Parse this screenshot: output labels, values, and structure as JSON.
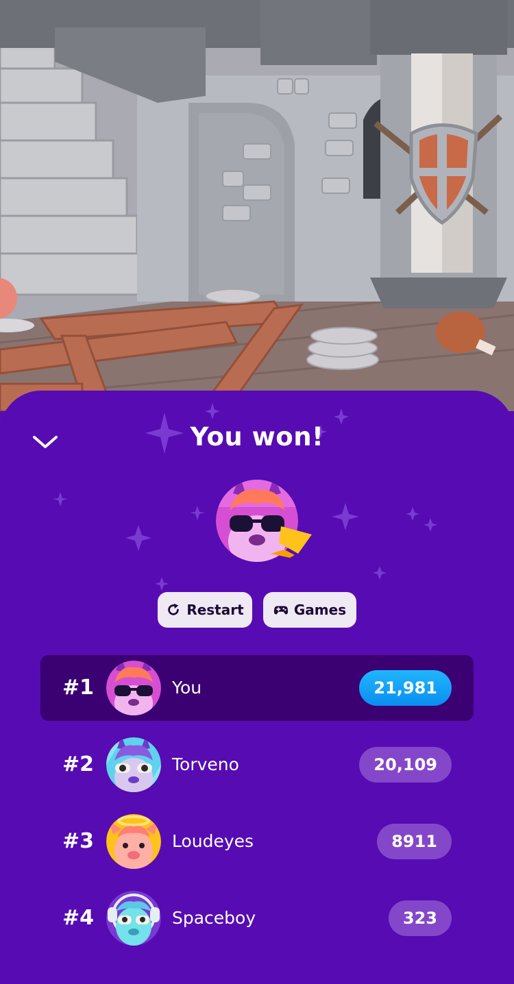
{
  "game": {
    "title": "You won!",
    "buttons": {
      "restart": "Restart",
      "games": "Games"
    }
  },
  "icons": [
    "chevron-down-icon",
    "restart-icon",
    "gamepad-icon",
    "trophy-icon",
    "sparkle-icon"
  ],
  "colors": {
    "panel": "#560bb3",
    "highlight_row": "#3b0072",
    "score_pill": "#8447c9",
    "score_pill_self": "#0a8ef0",
    "button_bg": "#efe9f4"
  },
  "leaderboard": [
    {
      "rank": "#1",
      "name": "You",
      "score": "21,981"
    },
    {
      "rank": "#2",
      "name": "Torveno",
      "score": "20,109"
    },
    {
      "rank": "#3",
      "name": "Loudeyes",
      "score": "8911"
    },
    {
      "rank": "#4",
      "name": "Spaceboy",
      "score": "323"
    }
  ]
}
